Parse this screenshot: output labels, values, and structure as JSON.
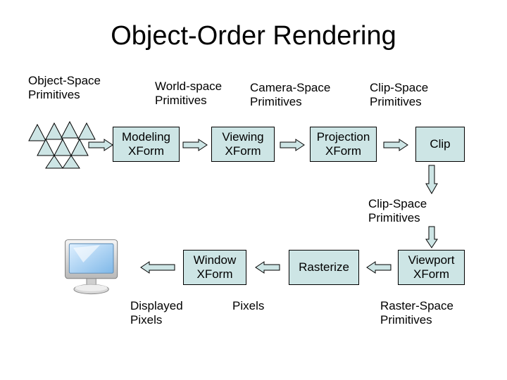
{
  "title": "Object-Order Rendering",
  "labels": {
    "objectSpace": "Object-Space\nPrimitives",
    "worldSpace": "World-space\nPrimitives",
    "cameraSpace": "Camera-Space\nPrimitives",
    "clipSpace": "Clip-Space\nPrimitives",
    "clipSpace2": "Clip-Space\nPrimitives",
    "pixels": "Pixels",
    "rasterSpace": "Raster-Space\nPrimitives",
    "displayed": "Displayed\nPixels"
  },
  "boxes": {
    "modeling": "Modeling\nXForm",
    "viewing": "Viewing\nXForm",
    "projection": "Projection\nXForm",
    "clip": "Clip",
    "window": "Window\nXForm",
    "rasterize": "Rasterize",
    "viewport": "Viewport\nXForm"
  }
}
